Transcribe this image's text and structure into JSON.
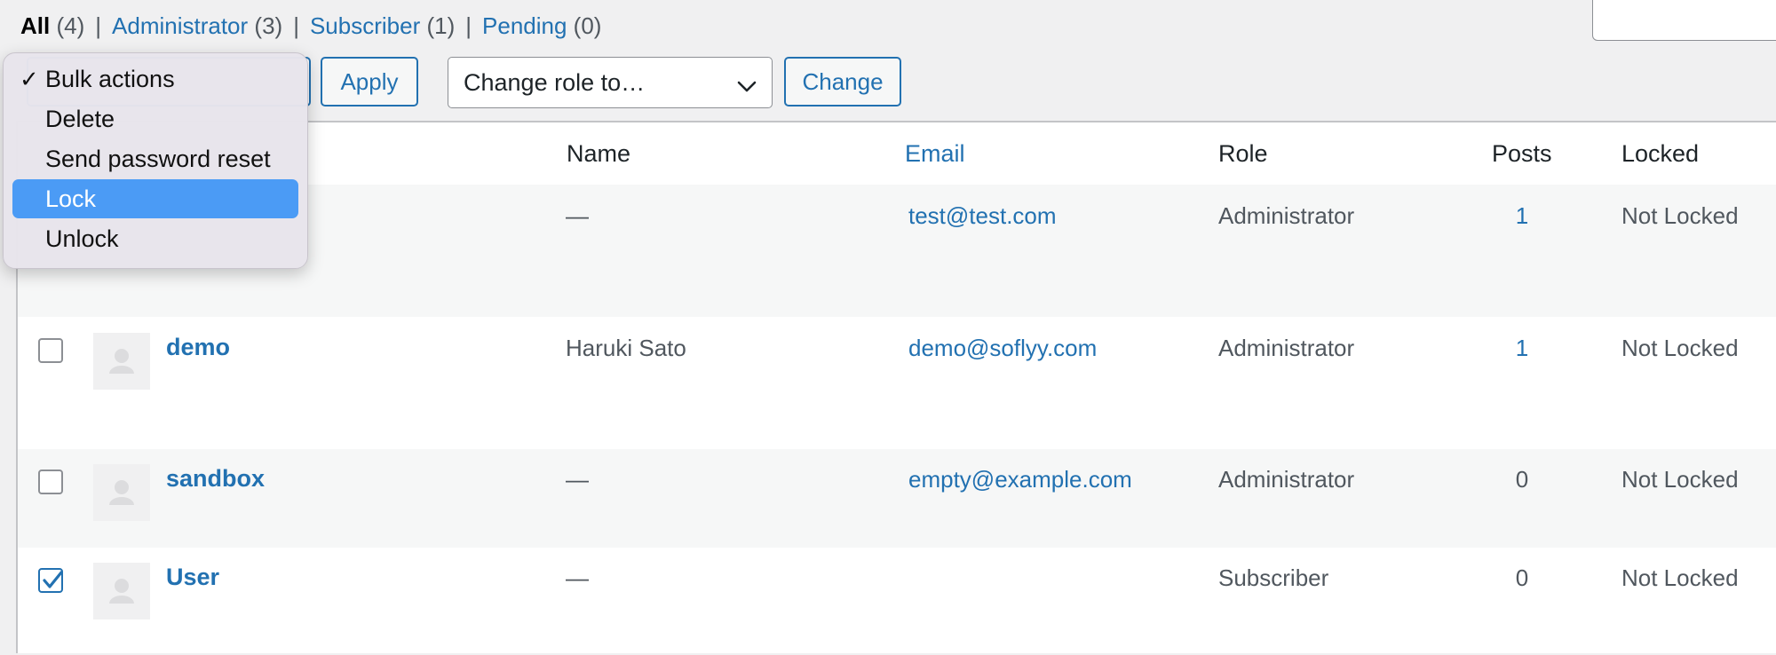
{
  "filters": [
    {
      "label": "All",
      "count": "(4)",
      "current": true
    },
    {
      "label": "Administrator",
      "count": "(3)",
      "current": false
    },
    {
      "label": "Subscriber",
      "count": "(1)",
      "current": false
    },
    {
      "label": "Pending",
      "count": "(0)",
      "current": false
    }
  ],
  "toolbar": {
    "apply_label": "Apply",
    "role_select_value": "Change role to…",
    "change_label": "Change"
  },
  "bulk_menu": {
    "options": [
      {
        "label": "Bulk actions",
        "checked": true,
        "highlighted": false
      },
      {
        "label": "Delete",
        "checked": false,
        "highlighted": false
      },
      {
        "label": "Send password reset",
        "checked": false,
        "highlighted": false
      },
      {
        "label": "Lock",
        "checked": false,
        "highlighted": true
      },
      {
        "label": "Unlock",
        "checked": false,
        "highlighted": false
      }
    ]
  },
  "table": {
    "headers": {
      "name": "Name",
      "email": "Email",
      "role": "Role",
      "posts": "Posts",
      "locked": "Locked"
    },
    "rows": [
      {
        "username": "",
        "name": "—",
        "email": "test@test.com",
        "role": "Administrator",
        "posts": "1",
        "locked": "Not Locked",
        "checked": false
      },
      {
        "username": "demo",
        "name": "Haruki Sato",
        "email": "demo@soflyy.com",
        "role": "Administrator",
        "posts": "1",
        "locked": "Not Locked",
        "checked": false
      },
      {
        "username": "sandbox",
        "name": "—",
        "email": "empty@example.com",
        "role": "Administrator",
        "posts": "0",
        "locked": "Not Locked",
        "checked": false
      },
      {
        "username": "User",
        "name": "—",
        "email": "",
        "role": "Subscriber",
        "posts": "0",
        "locked": "Not Locked",
        "checked": true
      }
    ]
  },
  "colors": {
    "accent": "#2271b1",
    "highlight": "#4b9bf5",
    "menu_bg": "#e8e4ec"
  },
  "icons": {
    "dropdown_chevron": "chevron-down-icon",
    "avatar": "default-avatar-icon",
    "checkmark": "checkmark-icon"
  }
}
